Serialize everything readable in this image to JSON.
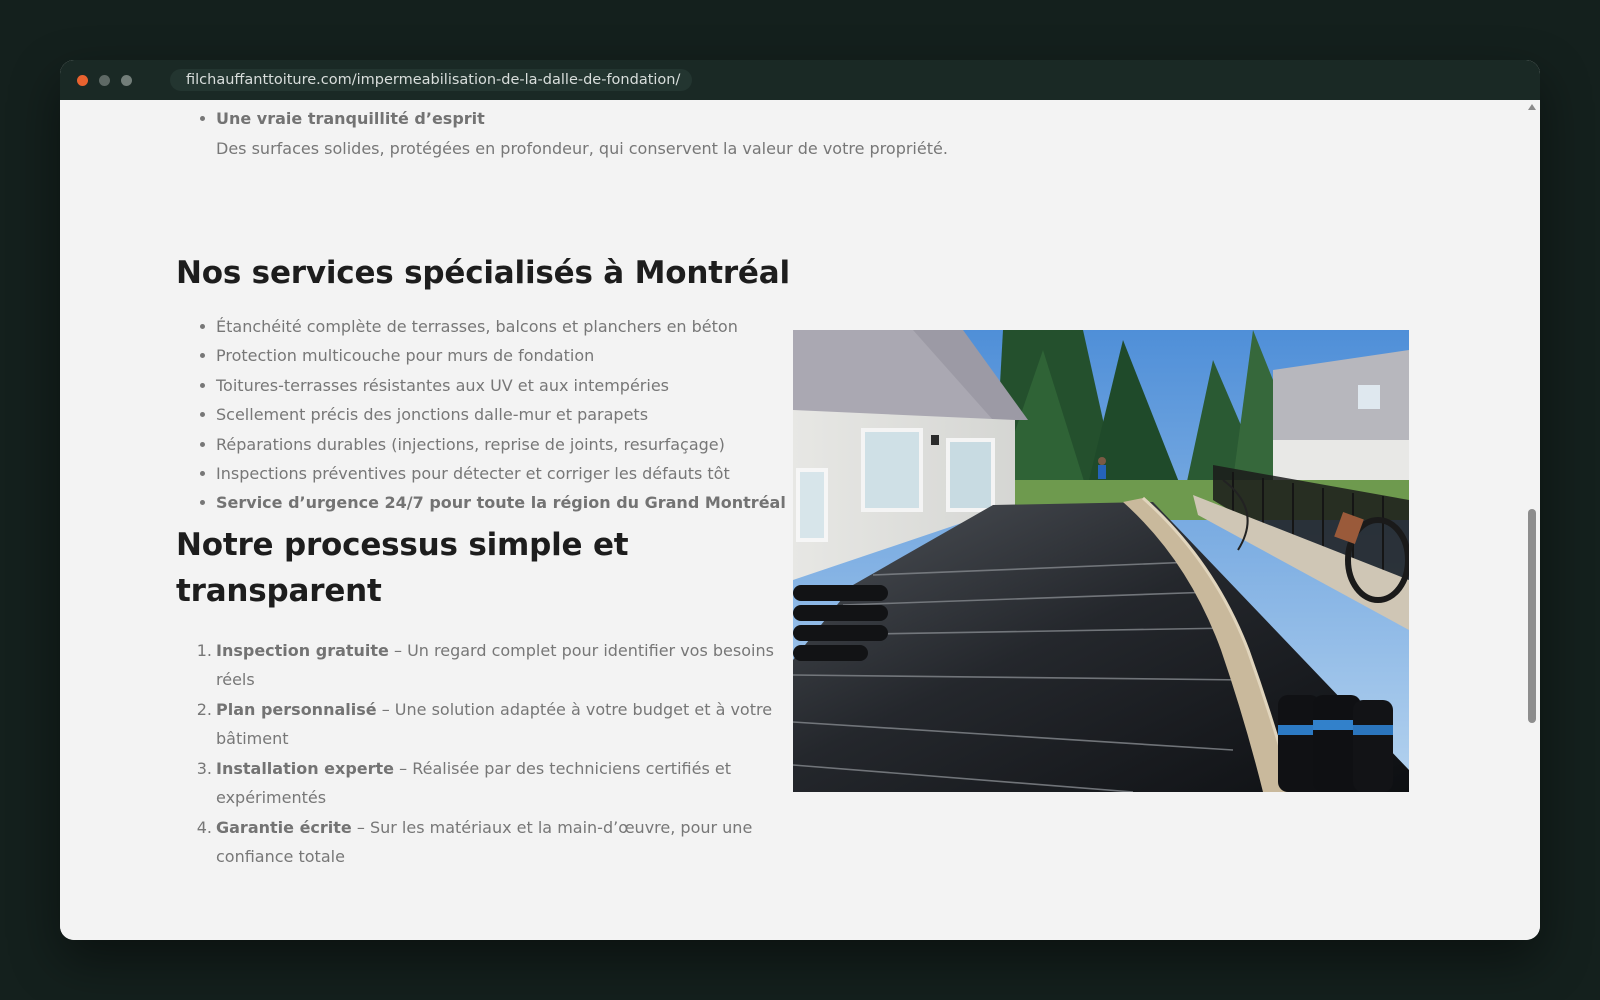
{
  "browser": {
    "url": "filchauffanttoiture.com/impermeabilisation-de-la-dalle-de-fondation/"
  },
  "top_item": {
    "title": "Une vraie tranquillité d’esprit",
    "description": "Des surfaces solides, protégées en profondeur, qui conservent la valeur de votre propriété."
  },
  "services": {
    "heading": "Nos services spécialisés à Montréal",
    "items": [
      "Étanchéité complète de terrasses, balcons et planchers en béton",
      "Protection multicouche pour murs de fondation",
      "Toitures-terrasses résistantes aux UV et aux intempéries",
      "Scellement précis des jonctions dalle-mur et parapets",
      "Réparations durables (injections, reprise de joints, resurfaçage)",
      "Inspections préventives pour détecter et corriger les défauts tôt",
      "Service d’urgence 24/7 pour toute la région du Grand Montréal"
    ]
  },
  "process": {
    "heading_line1": "Notre processus simple et",
    "heading_line2": "transparent",
    "steps": [
      {
        "number": "1.",
        "title": "Inspection gratuite",
        "text_line1": " – Un regard complet pour identifier vos besoins",
        "text_line2": "réels"
      },
      {
        "number": "2.",
        "title": "Plan personnalisé",
        "text_line1": " – Une solution adaptée à votre budget et à votre",
        "text_line2": "bâtiment"
      },
      {
        "number": "3.",
        "title": "Installation experte",
        "text_line1": " – Réalisée par des techniciens certifiés et",
        "text_line2": "expérimentés"
      },
      {
        "number": "4.",
        "title": "Garantie écrite",
        "text_line1": " – Sur les matériaux et la main-d’œuvre, pour une",
        "text_line2": "confiance totale"
      }
    ]
  },
  "colors": {
    "page_background": "#14201d",
    "titlebar": "#1a2925",
    "content_background": "#f3f3f3",
    "heading": "#1d1d1d",
    "body_text": "#777777",
    "close_dot": "#e9622f"
  },
  "icons": {
    "window_close": "close-dot-icon",
    "window_minimize": "minimize-dot-icon",
    "window_zoom": "zoom-dot-icon",
    "scroll_up": "scroll-up-arrow-icon"
  }
}
